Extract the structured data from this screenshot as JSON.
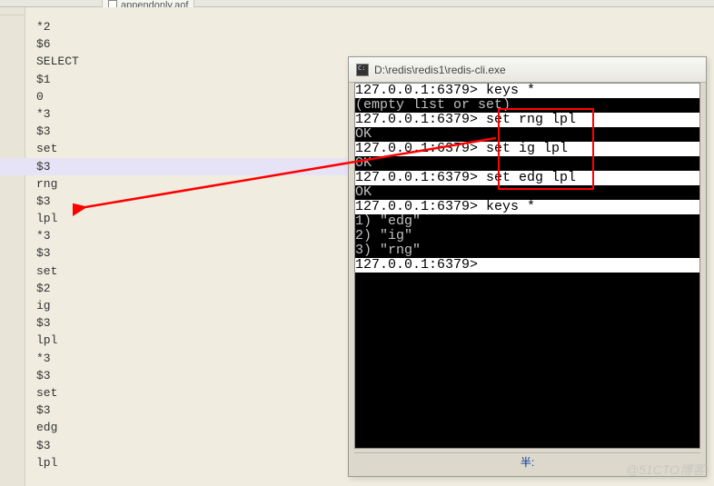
{
  "tab": {
    "filename": "appendonly.aof"
  },
  "editor_lines": [
    "*2",
    "$6",
    "SELECT",
    "$1",
    "0",
    "*3",
    "$3",
    "set",
    "$3",
    "rng",
    "$3",
    "lpl",
    "*3",
    "$3",
    "set",
    "$2",
    "ig",
    "$3",
    "lpl",
    "*3",
    "$3",
    "set",
    "$3",
    "edg",
    "$3",
    "lpl"
  ],
  "highlighted_index": 8,
  "console": {
    "title": "D:\\redis\\redis1\\redis-cli.exe",
    "lines": [
      {
        "style": "sel",
        "text": "127.0.0.1:6379> keys *"
      },
      {
        "style": "norm",
        "text": "(empty list or set)"
      },
      {
        "style": "sel",
        "text": "127.0.0.1:6379> set rng lpl"
      },
      {
        "style": "norm",
        "text": "OK"
      },
      {
        "style": "sel",
        "text": "127.0.0.1:6379> set ig lpl"
      },
      {
        "style": "norm",
        "text": "OK"
      },
      {
        "style": "sel",
        "text": "127.0.0.1:6379> set edg lpl"
      },
      {
        "style": "norm",
        "text": "OK"
      },
      {
        "style": "sel",
        "text": "127.0.0.1:6379> keys *"
      },
      {
        "style": "norm",
        "text": "1) \"edg\""
      },
      {
        "style": "norm",
        "text": "2) \"ig\""
      },
      {
        "style": "norm",
        "text": "3) \"rng\""
      },
      {
        "style": "sel",
        "text": "127.0.0.1:6379> "
      }
    ],
    "status": "半:"
  },
  "watermark": "@51CTO博客"
}
